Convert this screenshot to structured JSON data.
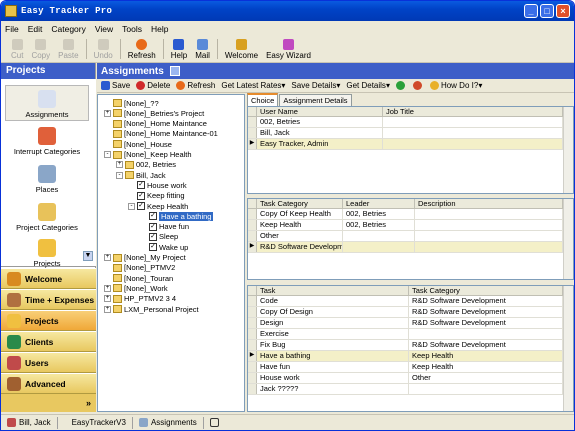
{
  "window": {
    "title": "Easy Tracker Pro"
  },
  "menu": [
    "File",
    "Edit",
    "Category",
    "View",
    "Tools",
    "Help"
  ],
  "toolbar": [
    {
      "label": "Cut",
      "enabled": false,
      "icon": "cut-icon"
    },
    {
      "label": "Copy",
      "enabled": false,
      "icon": "copy-icon"
    },
    {
      "label": "Paste",
      "enabled": false,
      "icon": "paste-icon"
    },
    {
      "label": "Undo",
      "enabled": false,
      "icon": "undo-icon"
    },
    {
      "label": "Refresh",
      "enabled": true,
      "icon": "refresh-icon"
    },
    {
      "label": "Help",
      "enabled": true,
      "icon": "help-icon"
    },
    {
      "label": "Mail",
      "enabled": true,
      "icon": "mail-icon"
    },
    {
      "label": "Welcome",
      "enabled": true,
      "icon": "welcome-icon"
    },
    {
      "label": "Easy Wizard",
      "enabled": true,
      "icon": "wizard-icon"
    }
  ],
  "left": {
    "header": "Projects",
    "items": [
      "Assignments",
      "Interrupt Categories",
      "Places",
      "Project Categories",
      "Projects"
    ],
    "buttons": [
      "Welcome",
      "Time + Expenses",
      "Projects",
      "Clients",
      "Users",
      "Advanced"
    ],
    "expand": "»"
  },
  "main": {
    "header": "Assignments",
    "tools": [
      "Save",
      "Delete",
      "Refresh",
      "Get Latest Rates",
      "Save Details",
      "Get Details",
      "How Do I?"
    ]
  },
  "tree": [
    {
      "d": 0,
      "t": "[None]_??",
      "e": ""
    },
    {
      "d": 0,
      "t": "[None]_Betries's Project",
      "e": "+"
    },
    {
      "d": 0,
      "t": "[None]_Home Maintance",
      "e": ""
    },
    {
      "d": 0,
      "t": "[None]_Home Maintance-01",
      "e": ""
    },
    {
      "d": 0,
      "t": "[None]_House",
      "e": ""
    },
    {
      "d": 0,
      "t": "[None]_Keep Health",
      "e": "-"
    },
    {
      "d": 1,
      "t": "002, Betries",
      "e": "+"
    },
    {
      "d": 1,
      "t": "Bill, Jack",
      "e": "-"
    },
    {
      "d": 2,
      "t": "House work",
      "e": "",
      "c": true
    },
    {
      "d": 2,
      "t": "Keep fitting",
      "e": "",
      "c": true
    },
    {
      "d": 2,
      "t": "Keep Health",
      "e": "-",
      "c": true
    },
    {
      "d": 3,
      "t": "Have a bathing",
      "e": "",
      "c": true,
      "sel": true
    },
    {
      "d": 3,
      "t": "Have fun",
      "e": "",
      "c": true
    },
    {
      "d": 3,
      "t": "Sleep",
      "e": "",
      "c": true
    },
    {
      "d": 3,
      "t": "Wake up",
      "e": "",
      "c": true
    },
    {
      "d": 0,
      "t": "[None]_My Project",
      "e": "+"
    },
    {
      "d": 0,
      "t": "[None]_PTMV2",
      "e": ""
    },
    {
      "d": 0,
      "t": "[None]_Touran",
      "e": ""
    },
    {
      "d": 0,
      "t": "[None]_Work",
      "e": "+"
    },
    {
      "d": 0,
      "t": "HP_PTMV2 3 4",
      "e": "+"
    },
    {
      "d": 0,
      "t": "LXM_Personal Project",
      "e": "+"
    }
  ],
  "tabs": [
    "Choice",
    "Assignment Details"
  ],
  "users": {
    "cols": [
      "User Name",
      "Job Title"
    ],
    "rows": [
      [
        "002, Betries",
        ""
      ],
      [
        "Bill, Jack",
        ""
      ],
      [
        "Easy Tracker, Admin",
        ""
      ]
    ]
  },
  "tcat": {
    "cols": [
      "Task Category",
      "Leader",
      "Description"
    ],
    "rows": [
      [
        "Copy Of Keep Health",
        "002, Betries",
        ""
      ],
      [
        "Keep Health",
        "002, Betries",
        ""
      ],
      [
        "Other",
        "",
        ""
      ],
      [
        "R&D Software Developmer",
        "",
        ""
      ]
    ]
  },
  "tasks": {
    "cols": [
      "Task",
      "Task Category"
    ],
    "rows": [
      [
        "Code",
        "R&D Software Development"
      ],
      [
        "Copy Of Design",
        "R&D Software Development"
      ],
      [
        "Design",
        "R&D Software Development"
      ],
      [
        "Exercise",
        ""
      ],
      [
        "Fix Bug",
        "R&D Software Development"
      ],
      [
        "Have a bathing",
        "Keep Health"
      ],
      [
        "Have fun",
        "Keep Health"
      ],
      [
        "House work",
        "Other"
      ],
      [
        "Jack ?????",
        ""
      ]
    ]
  },
  "status": [
    "Bill, Jack",
    "EasyTrackerV3",
    "Assignments"
  ]
}
